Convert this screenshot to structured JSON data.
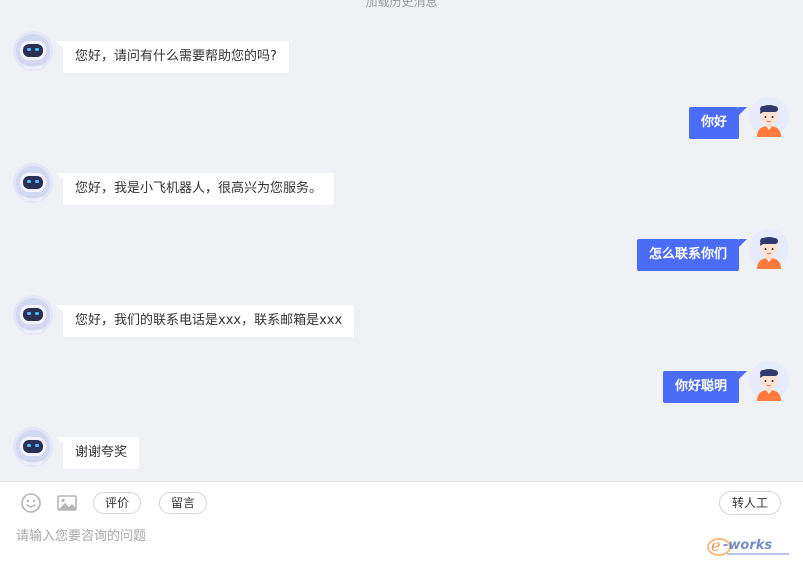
{
  "chat": {
    "load_history": "加载历史消息",
    "messages": [
      {
        "role": "bot",
        "text": "您好，请问有什么需要帮助您的吗?"
      },
      {
        "role": "user",
        "text": "你好"
      },
      {
        "role": "bot",
        "text": "您好，我是小飞机器人，很高兴为您服务。"
      },
      {
        "role": "user",
        "text": "怎么联系你们"
      },
      {
        "role": "bot",
        "text": "您好，我们的联系电话是xxx，联系邮箱是xxx"
      },
      {
        "role": "user",
        "text": "你好聪明"
      },
      {
        "role": "bot",
        "text": "谢谢夸奖"
      }
    ]
  },
  "toolbar": {
    "emoji_icon": "smiley-icon",
    "image_icon": "image-icon",
    "rate_label": "评价",
    "leave_message_label": "留言",
    "transfer_label": "转人工"
  },
  "input": {
    "placeholder": "请输入您要咨询的问题",
    "value": ""
  },
  "watermark": {
    "text": "e-works"
  },
  "colors": {
    "user_bubble": "#4a6cf7",
    "chat_background": "#f0f1f4",
    "bot_bubble": "#ffffff"
  }
}
